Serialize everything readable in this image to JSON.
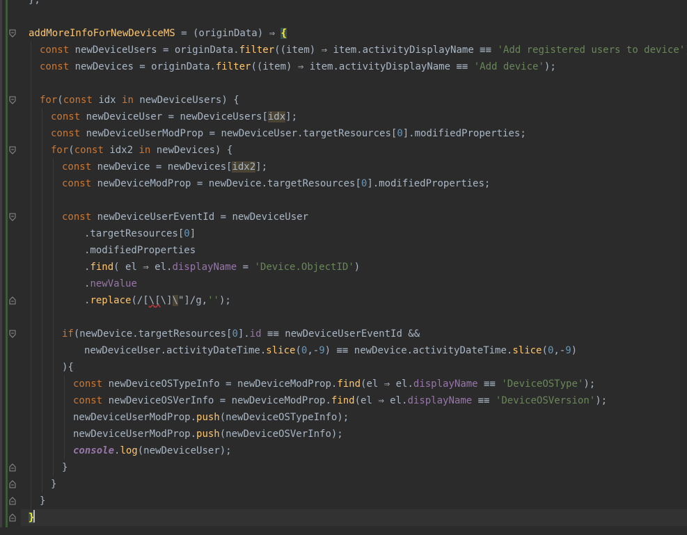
{
  "code": {
    "line_prev": "};",
    "l1": [
      "addMoreInfoForNewDeviceMS",
      " = (originData) ⇒ ",
      "{"
    ],
    "l2": [
      "const",
      " newDeviceUsers = originData.",
      "filter",
      "((item) ⇒ item.activityDisplayName ≡≡ ",
      "'Add registered users to device'",
      ");"
    ],
    "l3": [
      "const",
      " newDevices = originData.",
      "filter",
      "((item) ⇒ item.activityDisplayName ≡≡ ",
      "'Add device'",
      ");"
    ],
    "l5": [
      "for",
      "(",
      "const",
      " idx ",
      "in",
      " newDeviceUsers) {"
    ],
    "l6": [
      "const",
      " newDeviceUser = newDeviceUsers[",
      "idx",
      "];"
    ],
    "l7": [
      "const",
      " newDeviceUserModProp = newDeviceUser.targetResources[",
      "0",
      "].modifiedProperties;"
    ],
    "l8": [
      "for",
      "(",
      "const",
      " idx2 ",
      "in",
      " newDevices) {"
    ],
    "l9": [
      "const",
      " newDevice = newDevices[",
      "idx2",
      "];"
    ],
    "l10": [
      "const",
      " newDeviceModProp = newDevice.targetResources[",
      "0",
      "].modifiedProperties;"
    ],
    "l12": [
      "const",
      " newDeviceUserEventId = newDeviceUser"
    ],
    "l13": [
      ".targetResources[",
      "0",
      "]"
    ],
    "l14": [
      ".modifiedProperties"
    ],
    "l15": [
      ".",
      "find",
      "( el ⇒ el.",
      "displayName",
      " = ",
      "'Device.ObjectID'",
      ")"
    ],
    "l16": [
      ".",
      "newValue"
    ],
    "l17": [
      ".",
      "replace",
      "(/[",
      "\\",
      "[",
      "\\",
      "]",
      "\\",
      "\"]/g,",
      "''",
      ");"
    ],
    "l19": [
      "if",
      "(newDevice.targetResources[",
      "0",
      "].",
      "id",
      " ≡≡ newDeviceUserEventId &&"
    ],
    "l20": [
      "newDeviceUser.activityDateTime.",
      "slice",
      "(",
      "0",
      ",-",
      "9",
      ") ≡≡ newDevice.activityDateTime.",
      "slice",
      "(",
      "0",
      ",-",
      "9",
      ")"
    ],
    "l21": [
      "){"
    ],
    "l22": [
      "const",
      " newDeviceOSTypeInfo = newDeviceModProp.",
      "find",
      "(el ⇒ el.",
      "displayName",
      " ≡≡ ",
      "'DeviceOSType'",
      ");"
    ],
    "l23": [
      "const",
      " newDeviceOSVerInfo = newDeviceModProp.",
      "find",
      "(el ⇒ el.",
      "displayName",
      " ≡≡ ",
      "'DeviceOSVersion'",
      ");"
    ],
    "l24": [
      "newDeviceUserModProp.",
      "push",
      "(newDeviceOSTypeInfo);"
    ],
    "l25": [
      "newDeviceUserModProp.",
      "push",
      "(newDeviceOSVerInfo);"
    ],
    "l26": [
      "console",
      ".",
      "log",
      "(newDeviceUser);"
    ],
    "l27": [
      "}"
    ],
    "l28": [
      "}"
    ],
    "l29": [
      "}"
    ],
    "l30": [
      "}"
    ]
  }
}
